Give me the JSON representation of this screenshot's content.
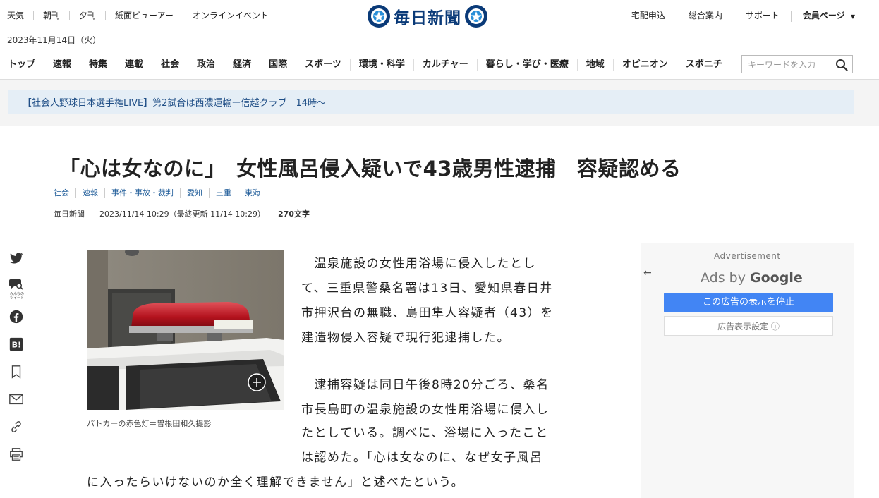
{
  "header": {
    "util_left": [
      "天気",
      "朝刊",
      "夕刊",
      "紙面ビューアー",
      "オンラインイベント"
    ],
    "util_right": [
      "宅配申込",
      "総合案内",
      "サポート"
    ],
    "member_label": "会員ページ",
    "date": "2023年11月14日（火）",
    "logo_text": "毎日新聞"
  },
  "nav": {
    "items": [
      "トップ",
      "速報",
      "特集",
      "連載",
      "社会",
      "政治",
      "経済",
      "国際",
      "スポーツ",
      "環境・科学",
      "カルチャー",
      "暮らし・学び・医療",
      "地域",
      "オピニオン",
      "スポニチ"
    ],
    "search_placeholder": "キーワードを入力"
  },
  "notice": "【社会人野球日本選手権LIVE】第2試合は西濃運輸ー信越クラブ　14時～",
  "article": {
    "headline": "「心は女なのに」　女性風呂侵入疑いで43歳男性逮捕　容疑認める",
    "tags": [
      "社会",
      "速報",
      "事件・事故・裁判",
      "愛知",
      "三重",
      "東海"
    ],
    "source": "毎日新聞",
    "datetime": "2023/11/14 10:29（最終更新 11/14 10:29）",
    "char_count": "270文字",
    "photo_caption": "パトカーの赤色灯＝曽根田和久撮影",
    "body_lines": [
      "　温泉施設の女性用浴場に侵入したとし",
      "て、三重県警桑名署は13日、愛知県春日井",
      "市押沢台の無職、島田隼人容疑者（43）を",
      "建造物侵入容疑で現行犯逮捕した。",
      "",
      "　逮捕容疑は同日午後8時20分ごろ、桑名",
      "市長島町の温泉施設の女性用浴場に侵入し",
      "たとしている。調べに、浴場に入ったこと",
      "は認めた。「心は女なのに、なぜ女子風呂",
      "に入ったらいけないのか全く理解できません」と述べたという。"
    ]
  },
  "share": {
    "minna_label": "みんなのツイート"
  },
  "ad": {
    "label": "Advertisement",
    "ads_by": "Ads by",
    "google": "Google",
    "stop_label": "この広告の表示を停止",
    "settings_label": "広告表示設定 ⓘ"
  },
  "colors": {
    "logo_blue": "#0a3a78",
    "notice_bg": "#e5eef6",
    "notice_text": "#1f4e86",
    "tag_link": "#1f5c99",
    "ad_button": "#4285f4"
  }
}
